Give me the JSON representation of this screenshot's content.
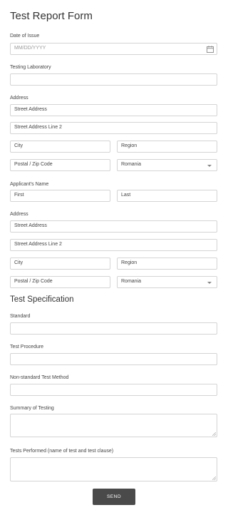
{
  "form": {
    "title": "Test Report Form",
    "date_of_issue": {
      "label": "Date of Issue",
      "placeholder": "MM/DD/YYYY"
    },
    "testing_laboratory": {
      "label": "Testing Laboratory"
    },
    "lab_address": {
      "label": "Address",
      "street": "Street Address",
      "street2": "Street Address Line 2",
      "city": "City",
      "region": "Region",
      "postal": "Postal / Zip Code",
      "country": "Romania"
    },
    "applicant_name": {
      "label": "Applicant's Name",
      "first": "First",
      "last": "Last"
    },
    "applicant_address": {
      "label": "Address",
      "street": "Street Address",
      "street2": "Street Address Line 2",
      "city": "City",
      "region": "Region",
      "postal": "Postal / Zip Code",
      "country": "Romania"
    },
    "test_spec_heading": "Test Specification",
    "standard": {
      "label": "Standard"
    },
    "test_procedure": {
      "label": "Test Procedure"
    },
    "non_standard_method": {
      "label": "Non-standard Test Method"
    },
    "summary": {
      "label": "Summary of Testing"
    },
    "tests_performed": {
      "label": "Tests Performed (name of test and test clause)"
    },
    "send_label": "SEND"
  }
}
